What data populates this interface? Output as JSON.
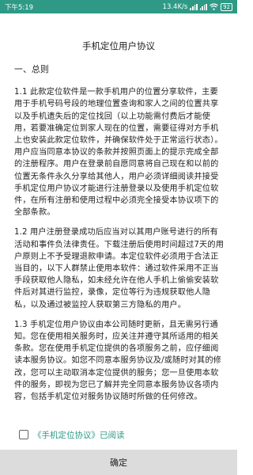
{
  "status_bar": {
    "time": "下午5:19",
    "speed": "13.4K/s",
    "battery": "92",
    "colors": {
      "background": "#2e9a86"
    }
  },
  "title": "手机定位用户协议",
  "section_heading": "一、总则",
  "paragraphs": [
    "1.1 此款定位软件是一款手机用户的位置分享软件，主要用于手机号码号段的地理位置查询和家人之间的位置共享以及手机遗失后的定位找回（以上功能需付费后才能使用，若要准确定位到家人现在的位置，需要征得对方手机上也安装此款定位软件，并确保软件处于正常运行状态）。用户应当同意本协议的条款并按照页面上的提示完成全部的注册程序。用户在登录前自愿同意将自己现在和以前的位置无条件永久分享给其他人，用户必须详细阅读并接受手机定位用户协议才能进行注册登录以及使用手机定位软件，在所有注册和使用过程中必须完全接受本协议项下的全部条款。",
    "1.2 用户注册登录成功后应当对以其用户账号进行的所有活动和事件负法律责任。下载注册后使用时间超过7天的用户原则上不予受理退款申请。本定位软件必须用于合法正当目的，以下人群禁止使用本软件：通过软件采用不正当手段获取他人隐私，如未经允许在他人手机上偷偷安装软件后对其进行监控，录像，定位等行为违规获取他人隐私，以及通过被监控人获取第三方隐私的用户。",
    "1.3 手机定位用户协议由本公司随时更新，且无需另行通知。您在使用相关服务时，应关注并遵守其所适用的相关条款。您在使用手机定位提供的各项服务之前，应仔细阅读本服务协议。如您不同意本服务协议及/或随时对其的修改，您可以主动取消本定位提供的服务；您一旦使用本软件的服务，即视为您已了解并完全同意本服务协议各项内容，包括手机定位对服务协议随时所做的任何修改。"
  ],
  "agreement": {
    "link": "《手机定位协议》",
    "suffix": "已阅读"
  },
  "confirm_label": "确定"
}
